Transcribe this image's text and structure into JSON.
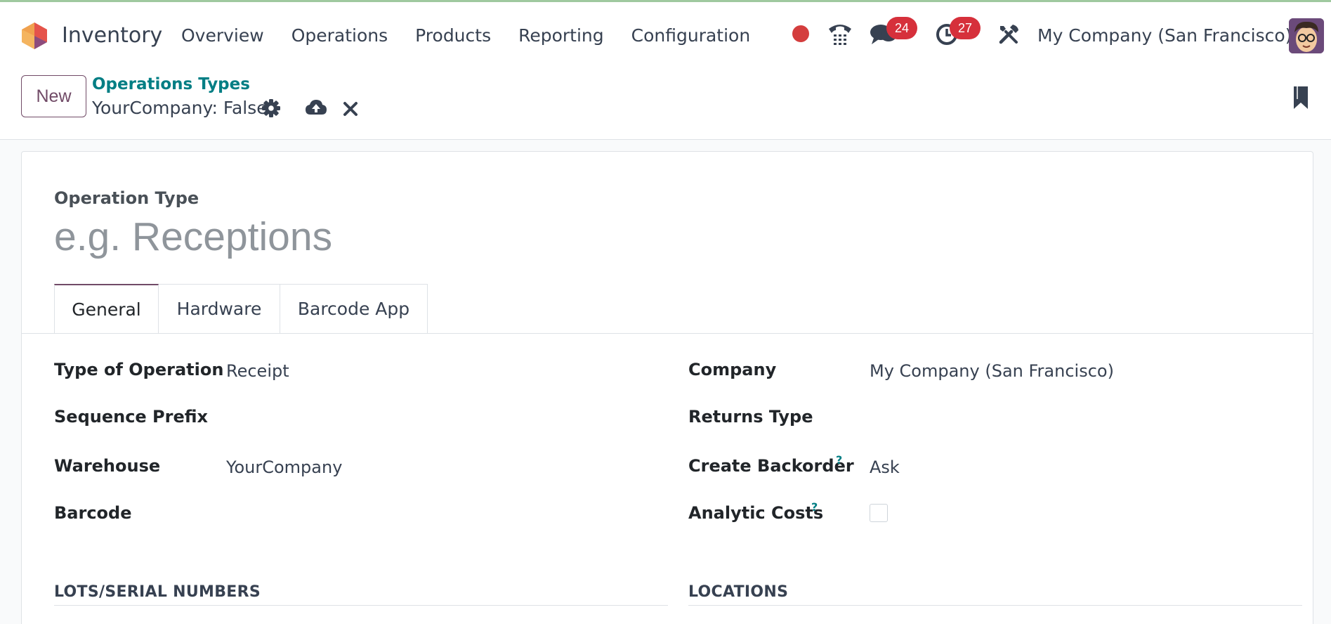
{
  "app": {
    "name": "Inventory"
  },
  "menu": [
    "Overview",
    "Operations",
    "Products",
    "Reporting",
    "Configuration"
  ],
  "systray": {
    "chat_count": "24",
    "activity_count": "27",
    "company": "My Company (San Francisco)"
  },
  "control_panel": {
    "new_label": "New",
    "breadcrumb": "Operations Types",
    "record_title": "YourCompany: False"
  },
  "form": {
    "name_label": "Operation Type",
    "name_placeholder": "e.g. Receptions",
    "tabs": [
      "General",
      "Hardware",
      "Barcode App"
    ],
    "left_fields": [
      {
        "label": "Type of Operation",
        "value": "Receipt"
      },
      {
        "label": "Sequence Prefix",
        "value": ""
      },
      {
        "label": "Warehouse",
        "value": "YourCompany"
      },
      {
        "label": "Barcode",
        "value": ""
      }
    ],
    "right_fields": [
      {
        "label": "Company",
        "value": "My Company (San Francisco)"
      },
      {
        "label": "Returns Type",
        "value": ""
      },
      {
        "label": "Create Backorder",
        "value": "Ask",
        "help": "?"
      },
      {
        "label": "Analytic Costs",
        "value": "",
        "help": "?",
        "checked": false
      }
    ],
    "sections": [
      "LOTS/SERIAL NUMBERS",
      "LOCATIONS"
    ]
  },
  "colors": {
    "brand": "#714b67",
    "link": "#017e84",
    "badge": "#d6303b",
    "record_dot": "#d43d3d"
  }
}
